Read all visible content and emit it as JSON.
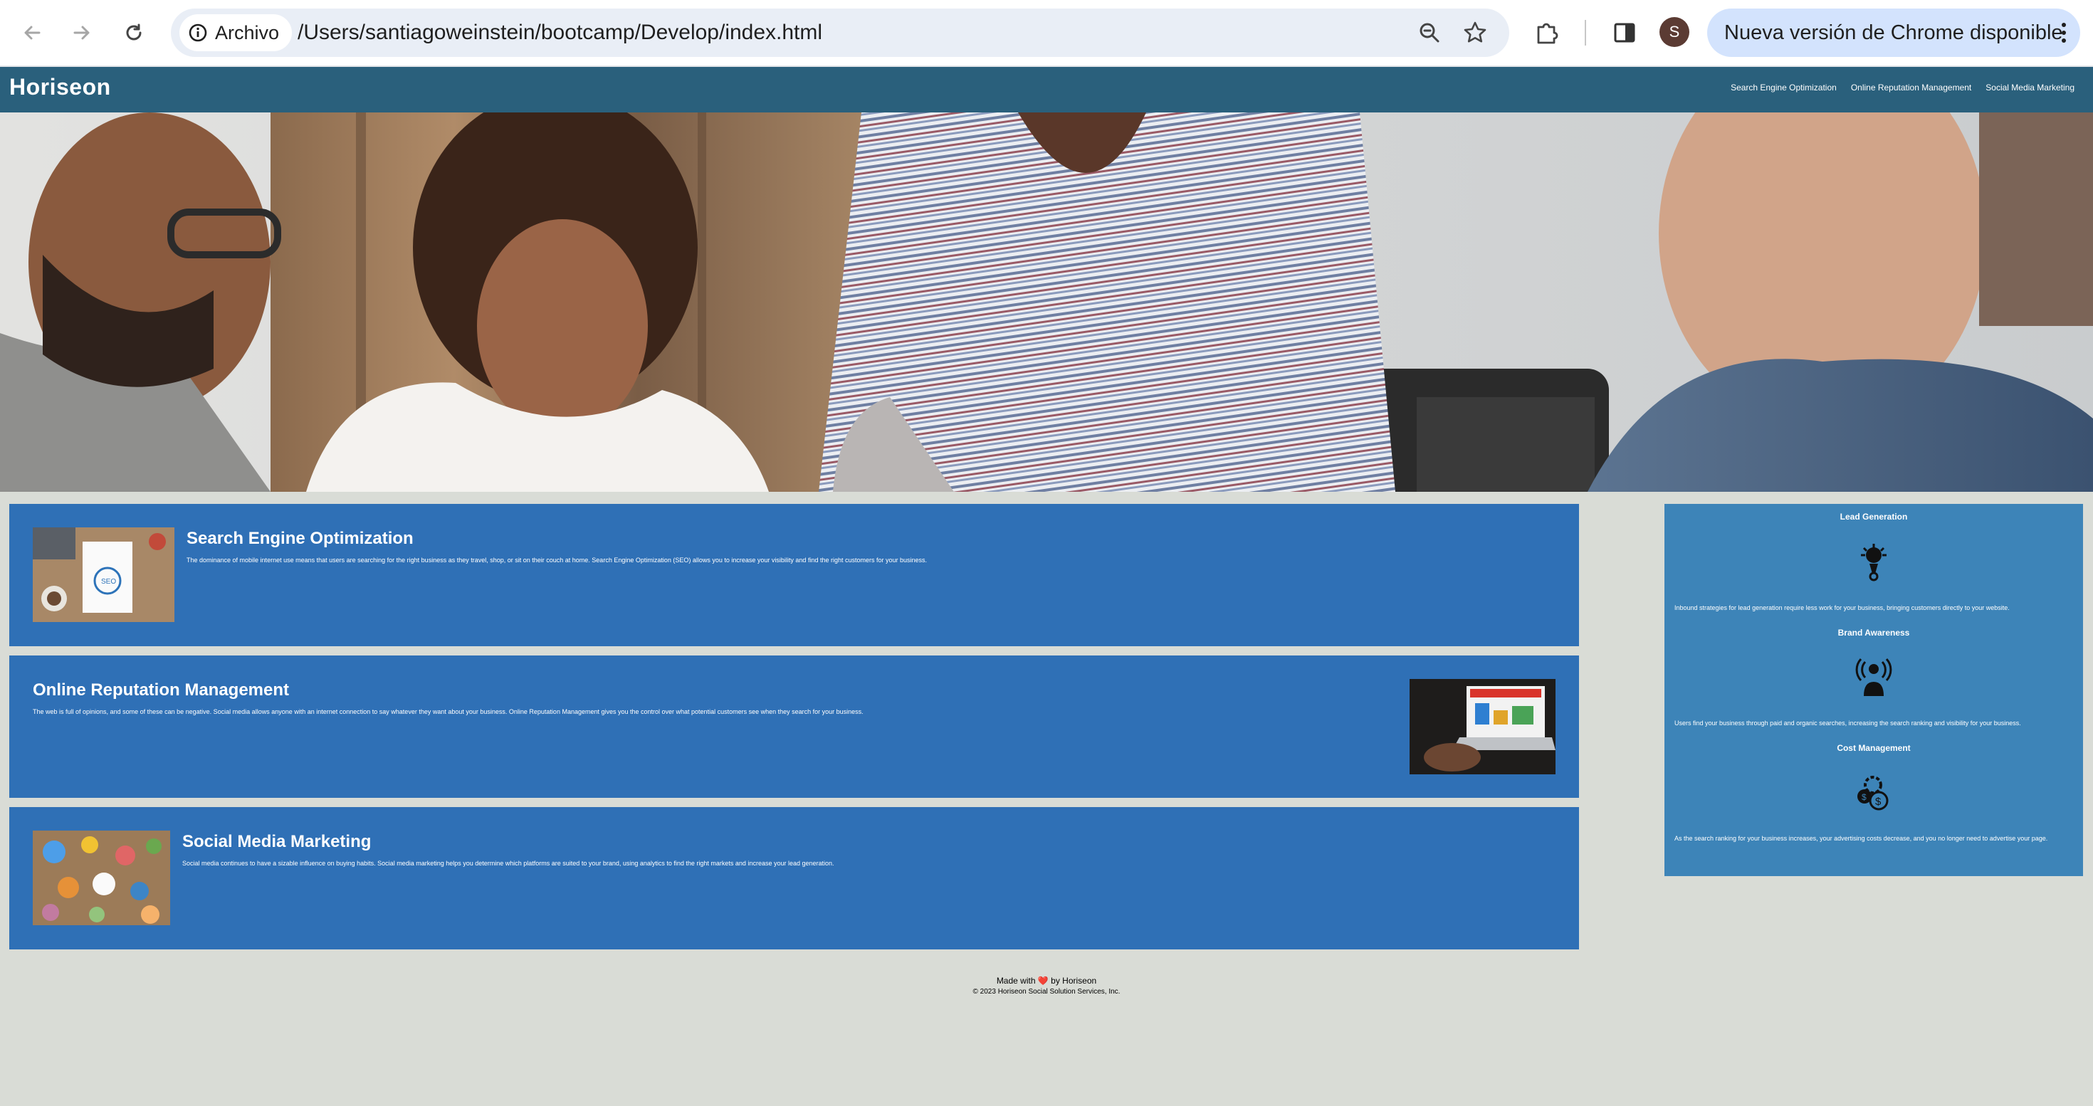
{
  "browser": {
    "site_chip_label": "Archivo",
    "url": "/Users/santiagoweinstein/bootcamp/Develop/index.html",
    "profile_initial": "S",
    "update_label": "Nueva versión de Chrome disponible"
  },
  "header": {
    "logo": "Horiseon",
    "nav": [
      "Search Engine Optimization",
      "Online Reputation Management",
      "Social Media Marketing"
    ]
  },
  "content": [
    {
      "title": "Search Engine Optimization",
      "text": "The dominance of mobile internet use means that users are searching for the right business as they travel, shop, or sit on their couch at home. Search Engine Optimization (SEO) allows you to increase your visibility and find the right customers for your business."
    },
    {
      "title": "Online Reputation Management",
      "text": "The web is full of opinions, and some of these can be negative. Social media allows anyone with an internet connection to say whatever they want about your business. Online Reputation Management gives you the control over what potential customers see when they search for your business."
    },
    {
      "title": "Social Media Marketing",
      "text": "Social media continues to have a sizable influence on buying habits. Social media marketing helps you determine which platforms are suited to your brand, using analytics to find the right markets and increase your lead generation."
    }
  ],
  "benefits": [
    {
      "title": "Lead Generation",
      "icon": "lead-generation-icon",
      "text": "Inbound strategies for lead generation require less work for your business, bringing customers directly to your website."
    },
    {
      "title": "Brand Awareness",
      "icon": "brand-awareness-icon",
      "text": "Users find your business through paid and organic searches, increasing the search ranking and visibility for your business."
    },
    {
      "title": "Cost Management",
      "icon": "cost-management-icon",
      "text": "As the search ranking for your business increases, your advertising costs decrease, and you no longer need to advertise your page."
    }
  ],
  "footer": {
    "made_with_prefix": "Made with",
    "heart": "❤️",
    "made_with_suffix": "by Horiseon",
    "copyright": "© 2023 Horiseon Social Solution Services, Inc."
  },
  "colors": {
    "header": "#2a607c",
    "card": "#2f70b6",
    "benefits": "#3d84b8",
    "page_background": "#d9dcd6"
  }
}
